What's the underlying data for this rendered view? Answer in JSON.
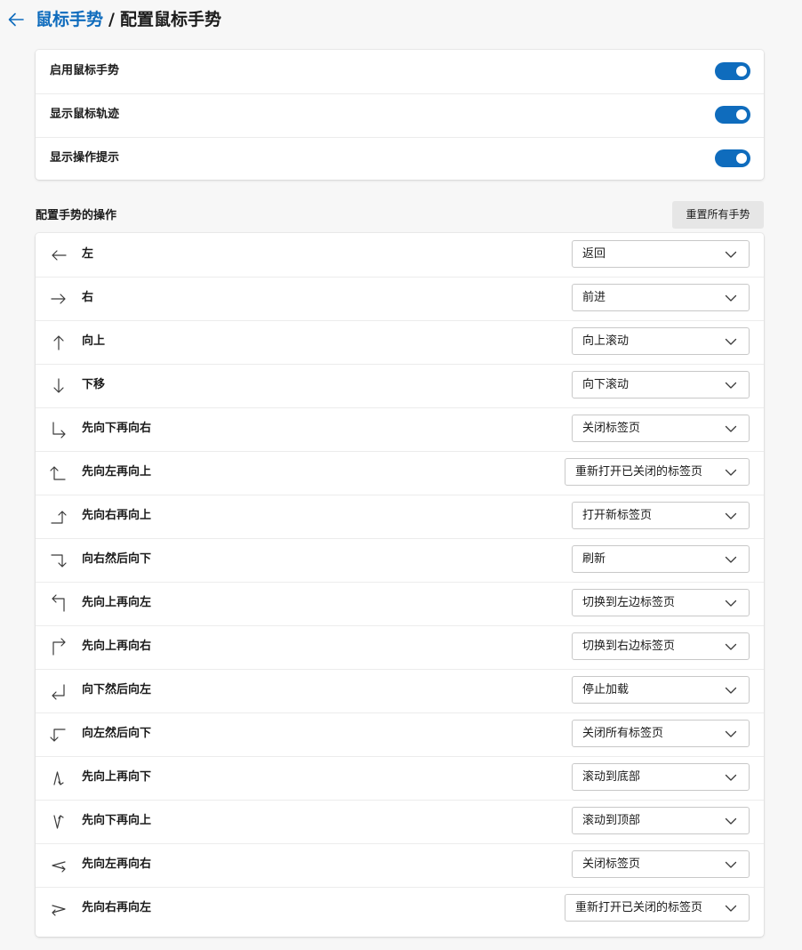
{
  "breadcrumb": {
    "parent": "鼠标手势",
    "separator": "/",
    "current": "配置鼠标手势"
  },
  "toggles": [
    {
      "label": "启用鼠标手势",
      "on": true
    },
    {
      "label": "显示鼠标轨迹",
      "on": true
    },
    {
      "label": "显示操作提示",
      "on": true
    }
  ],
  "section": {
    "title": "配置手势的操作",
    "reset_label": "重置所有手势"
  },
  "gestures": [
    {
      "label": "左",
      "action": "返回",
      "icon": "arrow-left-icon"
    },
    {
      "label": "右",
      "action": "前进",
      "icon": "arrow-right-icon"
    },
    {
      "label": "向上",
      "action": "向上滚动",
      "icon": "arrow-up-icon"
    },
    {
      "label": "下移",
      "action": "向下滚动",
      "icon": "arrow-down-icon"
    },
    {
      "label": "先向下再向右",
      "action": "关闭标签页",
      "icon": "down-then-right-icon"
    },
    {
      "label": "先向左再向上",
      "action": "重新打开已关闭的标签页",
      "icon": "left-then-up-icon"
    },
    {
      "label": "先向右再向上",
      "action": "打开新标签页",
      "icon": "right-then-up-icon"
    },
    {
      "label": "向右然后向下",
      "action": "刷新",
      "icon": "right-then-down-icon"
    },
    {
      "label": "先向上再向左",
      "action": "切换到左边标签页",
      "icon": "up-then-left-icon"
    },
    {
      "label": "先向上再向右",
      "action": "切换到右边标签页",
      "icon": "up-then-right-icon"
    },
    {
      "label": "向下然后向左",
      "action": "停止加载",
      "icon": "down-then-left-icon"
    },
    {
      "label": "向左然后向下",
      "action": "关闭所有标签页",
      "icon": "left-then-down-icon"
    },
    {
      "label": "先向上再向下",
      "action": "滚动到底部",
      "icon": "up-then-down-icon"
    },
    {
      "label": "先向下再向上",
      "action": "滚动到顶部",
      "icon": "down-then-up-icon"
    },
    {
      "label": "先向左再向右",
      "action": "关闭标签页",
      "icon": "left-then-right-icon"
    },
    {
      "label": "先向右再向左",
      "action": "重新打开已关闭的标签页",
      "icon": "right-then-left-icon"
    }
  ],
  "colors": {
    "accent": "#0f6cbd",
    "background": "#f7f7f7",
    "card": "#ffffff"
  }
}
